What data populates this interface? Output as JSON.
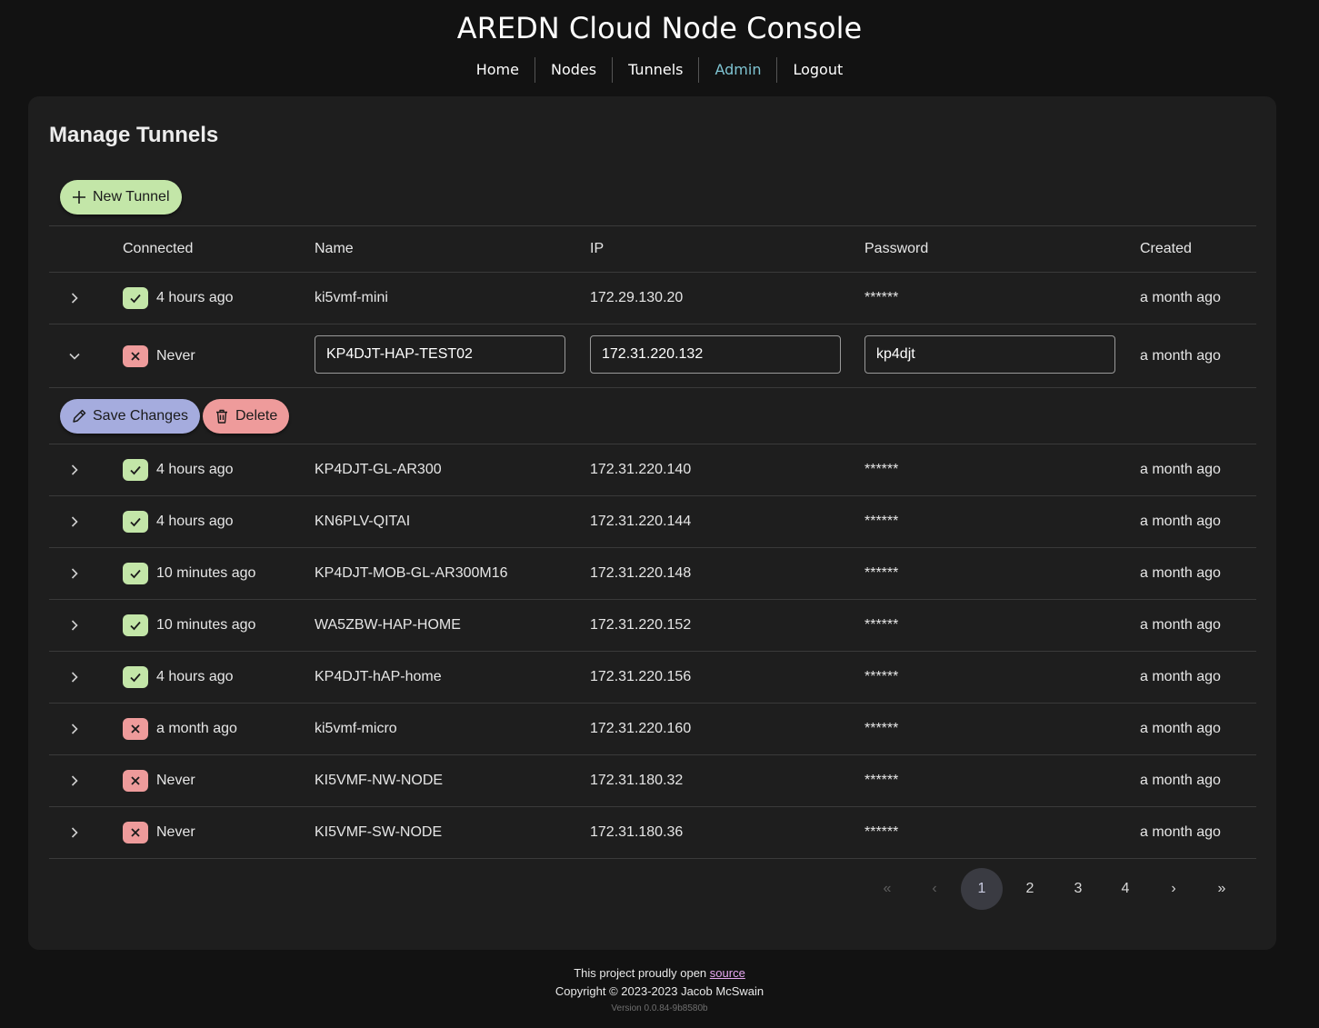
{
  "app": {
    "title": "AREDN Cloud Node Console"
  },
  "nav": {
    "home": "Home",
    "nodes": "Nodes",
    "tunnels": "Tunnels",
    "admin": "Admin",
    "logout": "Logout",
    "active": "admin"
  },
  "page": {
    "title": "Manage Tunnels",
    "new_tunnel_label": "New Tunnel"
  },
  "columns": {
    "connected": "Connected",
    "name": "Name",
    "ip": "IP",
    "password": "Password",
    "created": "Created"
  },
  "rows": [
    {
      "connected": true,
      "last_seen": "4 hours ago",
      "name": "ki5vmf-mini",
      "ip": "172.29.130.20",
      "password": "******",
      "created": "a month ago"
    },
    {
      "connected": false,
      "last_seen": "Never",
      "name": "KP4DJT-HAP-TEST02",
      "ip": "172.31.220.132",
      "password": "kp4djt",
      "created": "a month ago",
      "expanded": true
    },
    {
      "connected": true,
      "last_seen": "4 hours ago",
      "name": "KP4DJT-GL-AR300",
      "ip": "172.31.220.140",
      "password": "******",
      "created": "a month ago"
    },
    {
      "connected": true,
      "last_seen": "4 hours ago",
      "name": "KN6PLV-QITAI",
      "ip": "172.31.220.144",
      "password": "******",
      "created": "a month ago"
    },
    {
      "connected": true,
      "last_seen": "10 minutes ago",
      "name": "KP4DJT-MOB-GL-AR300M16",
      "ip": "172.31.220.148",
      "password": "******",
      "created": "a month ago"
    },
    {
      "connected": true,
      "last_seen": "10 minutes ago",
      "name": "WA5ZBW-HAP-HOME",
      "ip": "172.31.220.152",
      "password": "******",
      "created": "a month ago"
    },
    {
      "connected": true,
      "last_seen": "4 hours ago",
      "name": "KP4DJT-hAP-home",
      "ip": "172.31.220.156",
      "password": "******",
      "created": "a month ago"
    },
    {
      "connected": false,
      "last_seen": "a month ago",
      "name": "ki5vmf-micro",
      "ip": "172.31.220.160",
      "password": "******",
      "created": "a month ago"
    },
    {
      "connected": false,
      "last_seen": "Never",
      "name": "KI5VMF-NW-NODE",
      "ip": "172.31.180.32",
      "password": "******",
      "created": "a month ago"
    },
    {
      "connected": false,
      "last_seen": "Never",
      "name": "KI5VMF-SW-NODE",
      "ip": "172.31.180.36",
      "password": "******",
      "created": "a month ago"
    }
  ],
  "edit_actions": {
    "save": "Save Changes",
    "delete": "Delete"
  },
  "pagination": {
    "first": "«",
    "prev": "‹",
    "pages": [
      "1",
      "2",
      "3",
      "4"
    ],
    "current": "1",
    "next": "›",
    "last": "»"
  },
  "footer": {
    "line1_prefix": "This project proudly open ",
    "line1_link": "source",
    "copyright": "Copyright © 2023-2023 Jacob McSwain",
    "version": "Version 0.0.84-9b8580b"
  },
  "colors": {
    "accent_nav": "#7fc4d2",
    "ok": "#c3e6a8",
    "error": "#ee9b9b",
    "save": "#a5acde"
  }
}
